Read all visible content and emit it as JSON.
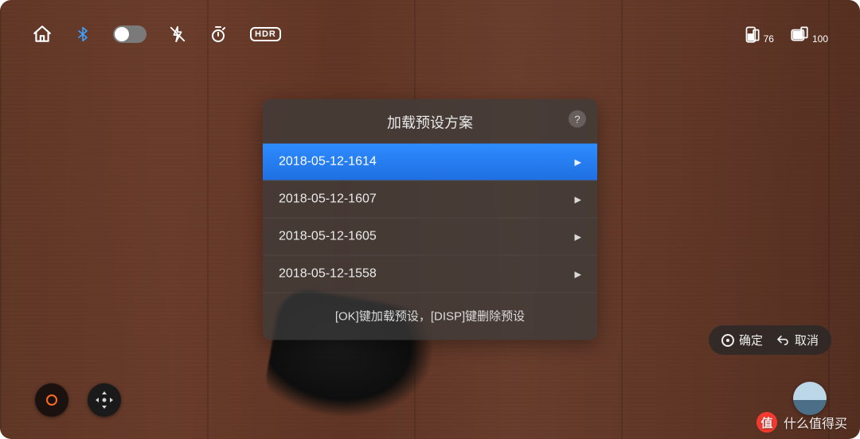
{
  "status": {
    "battery_phone": 76,
    "battery_cam": 100,
    "hdr_label": "HDR"
  },
  "modal": {
    "title": "加载预设方案",
    "help_symbol": "?",
    "hint": "[OK]键加载预设，[DISP]键删除预设",
    "presets": [
      {
        "label": "2018-05-12-1614",
        "selected": true
      },
      {
        "label": "2018-05-12-1607",
        "selected": false
      },
      {
        "label": "2018-05-12-1605",
        "selected": false
      },
      {
        "label": "2018-05-12-1558",
        "selected": false
      }
    ]
  },
  "actions": {
    "confirm": "确定",
    "cancel": "取消"
  },
  "watermark": {
    "badge": "值",
    "text": "什么值得买"
  }
}
